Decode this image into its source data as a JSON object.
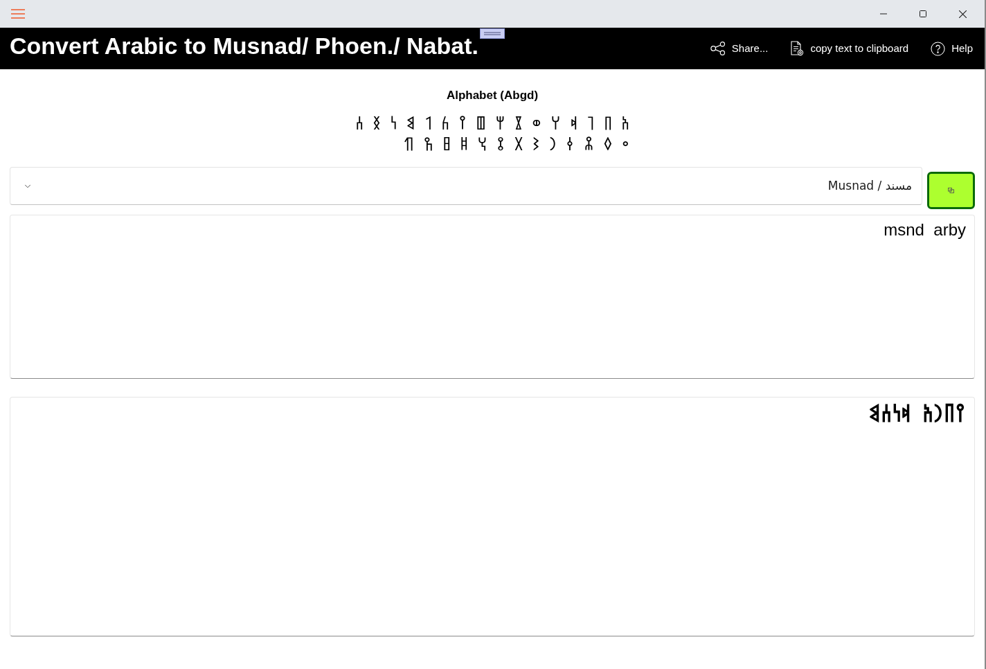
{
  "header": {
    "title": "Convert Arabic to Musnad/ Phoen./ Nabat.",
    "actions": [
      {
        "kind": "share",
        "label": "Share..."
      },
      {
        "kind": "copy",
        "label": "copy text to clipboard"
      },
      {
        "kind": "help",
        "label": "Help"
      }
    ]
  },
  "alphabet": {
    "title": "Alphabet (Abgd)",
    "lines": [
      "𐩱 𐩨 𐩴 𐩵 𐩠 𐩥 𐩸 𐩢 𐩷 𐩺 𐩫 𐩡 𐩣 𐩬 𐩯 𐩪",
      "𐩲 𐩰 𐩮 𐩤 𐩧 𐩦 𐩩 𐩻 𐩭 𐩹 𐩳 𐩼 𐩶"
    ]
  },
  "script_select": {
    "value": "Musnad / مسند"
  },
  "input": {
    "value": "msnd  arby"
  },
  "output": {
    "value": "𐩺𐩨𐩧𐩱  𐩵𐩬𐩪𐩣"
  }
}
